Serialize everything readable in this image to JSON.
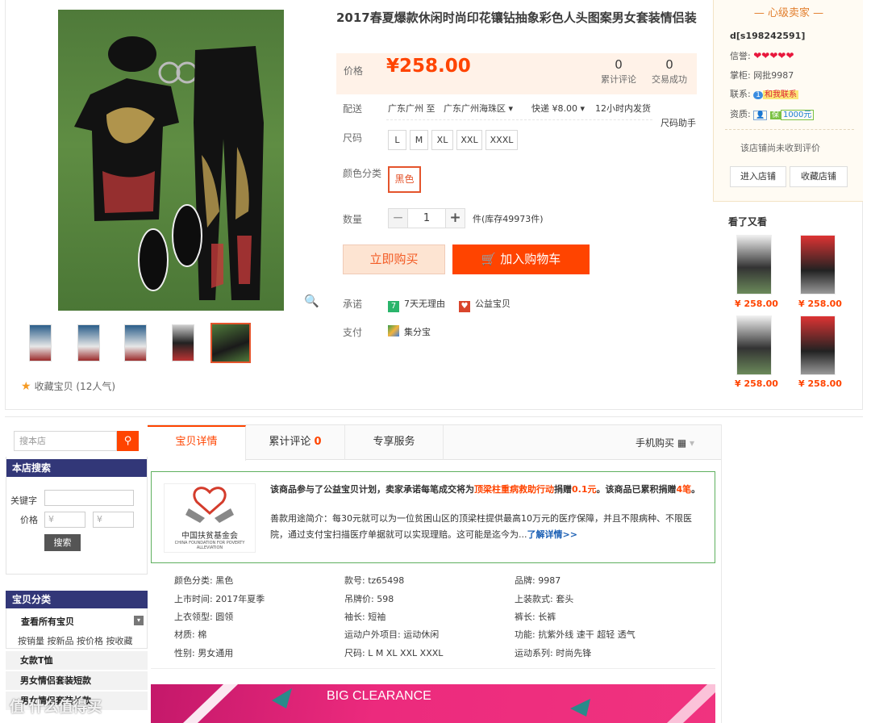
{
  "product": {
    "title": "2017春夏爆款休闲时尚印花镶钻抽象彩色人头图案男女套装情侣装",
    "price_label": "价格",
    "currency": "¥",
    "price": "258.00",
    "reviews_count": "0",
    "reviews_label": "累计评论",
    "sales_count": "0",
    "sales_label": "交易成功",
    "favorite": "收藏宝贝 (12人气)"
  },
  "shipping": {
    "label": "配送",
    "from": "广东广州 至",
    "to": "广东广州海珠区",
    "method": "快递 ¥8.00",
    "time": "12小时内发货",
    "size_helper": "尺码助手"
  },
  "size": {
    "label": "尺码",
    "options": [
      "L",
      "M",
      "XL",
      "XXL",
      "XXXL"
    ]
  },
  "color": {
    "label": "颜色分类",
    "selected": "黑色"
  },
  "quantity": {
    "label": "数量",
    "value": "1",
    "stock": "件(库存49973件)"
  },
  "actions": {
    "buy_now": "立即购买",
    "add_cart": "加入购物车"
  },
  "promise": {
    "label": "承诺",
    "items": [
      "7天无理由",
      "公益宝贝"
    ],
    "badge7": "7"
  },
  "payment": {
    "label": "支付",
    "method": "集分宝"
  },
  "seller": {
    "title": "— 心级卖家 —",
    "name": "d[s198242591]",
    "credit_label": "信誉:",
    "hearts": "❤❤❤❤❤",
    "keeper_label": "掌柜:",
    "keeper": "网批9987",
    "contact_label": "联系:",
    "contact": "和我联系",
    "qual_label": "资质:",
    "deposit": "1000元",
    "no_review": "该店铺尚未收到评价",
    "enter_shop": "进入店铺",
    "fav_shop": "收藏店铺"
  },
  "also_viewed": {
    "title": "看了又看",
    "items": [
      {
        "price": "¥ 258.00"
      },
      {
        "price": "¥ 258.00"
      },
      {
        "price": "¥ 258.00"
      },
      {
        "price": "¥ 258.00"
      }
    ]
  },
  "sidebar": {
    "search_placeholder": "搜本店",
    "shop_search_title": "本店搜索",
    "keyword_label": "关键字",
    "price_label": "价格",
    "price_min": "¥",
    "price_max": "¥",
    "search_btn": "搜索",
    "category_title": "宝贝分类",
    "all_items": "查看所有宝贝",
    "sort_links": "按销量 按新品 按价格 按收藏",
    "categories": [
      "女款T恤",
      "男女情侣套装短款",
      "男女情侣套装长款"
    ]
  },
  "tabs": {
    "detail": "宝贝详情",
    "reviews": "累计评论",
    "reviews_count": "0",
    "service": "专享服务",
    "mobile": "手机购买"
  },
  "charity": {
    "line1_a": "该商品参与了公益宝贝计划，卖家承诺每笔成交将为",
    "line1_b": "顶梁柱重病救助行动",
    "line1_c": "捐赠",
    "line1_d": "0.1元",
    "line1_e": "。该商品已累积捐赠",
    "line1_f": "4笔",
    "line1_g": "。",
    "line2": "善款用途简介：每30元就可以为一位贫困山区的顶梁柱提供最高10万元的医疗保障，并且不限病种、不限医院，通过支付宝扫描医疗单据就可以实现理赔。这可能是迄今为...",
    "more": "了解详情>>",
    "logo_text": "中国扶贫基金会",
    "logo_sub": "CHINA FOUNDATION FOR POVERTY ALLEVIATION"
  },
  "attributes": [
    [
      "颜色分类: 黑色",
      "款号: tz65498",
      "品牌: 9987"
    ],
    [
      "上市时间: 2017年夏季",
      "吊牌价: 598",
      "上装款式: 套头"
    ],
    [
      "上衣领型: 圆领",
      "袖长: 短袖",
      "裤长: 长裤"
    ],
    [
      "材质: 棉",
      "运动户外项目: 运动休闲",
      "功能: 抗紫外线 速干 超轻 透气"
    ],
    [
      "性别: 男女通用",
      "尺码: L M XL XXL XXXL",
      "运动系列: 时尚先锋"
    ]
  ],
  "banner": {
    "text": "BIG CLEARANCE"
  },
  "watermark": "值 什么值得买"
}
